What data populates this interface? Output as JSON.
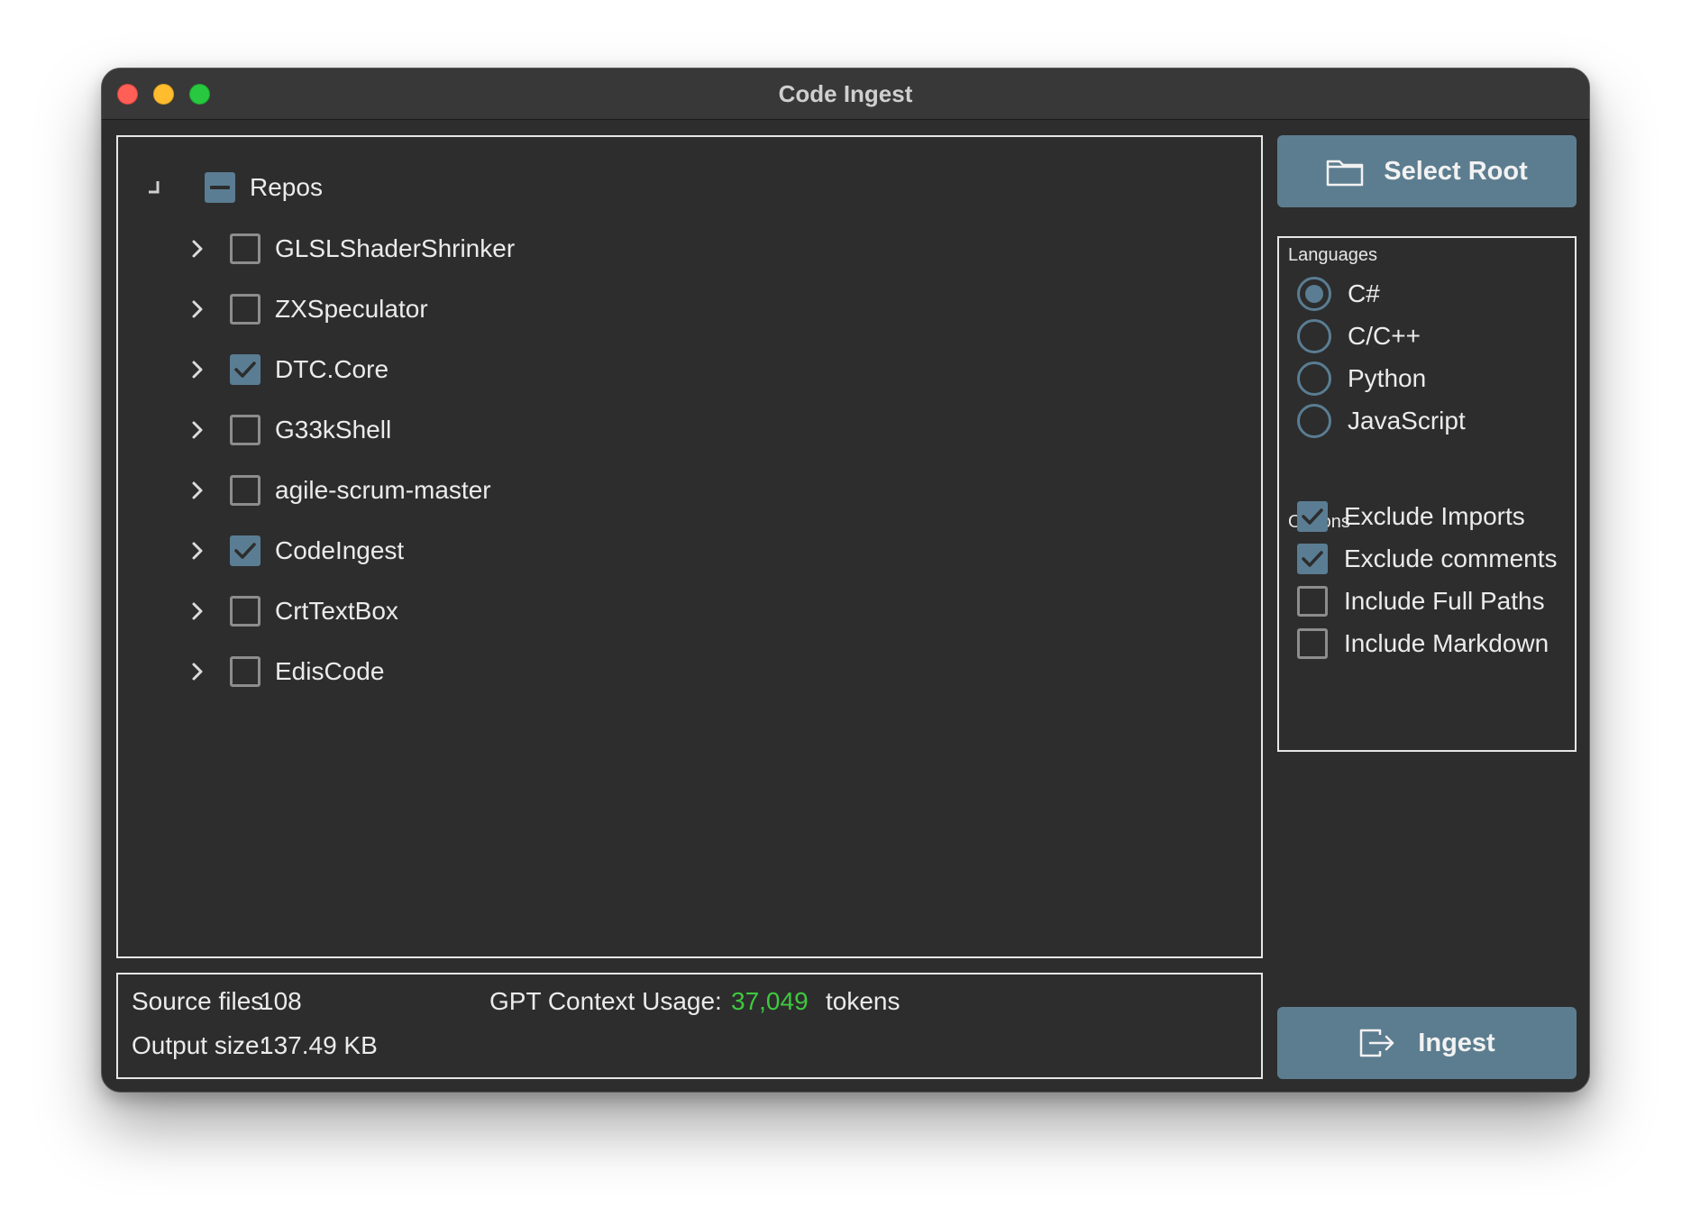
{
  "window": {
    "title": "Code Ingest"
  },
  "tree": {
    "root": {
      "label": "Repos",
      "state": "partial"
    },
    "items": [
      {
        "label": "GLSLShaderShrinker",
        "checked": false
      },
      {
        "label": "ZXSpeculator",
        "checked": false
      },
      {
        "label": "DTC.Core",
        "checked": true
      },
      {
        "label": "G33kShell",
        "checked": false
      },
      {
        "label": "agile-scrum-master",
        "checked": false
      },
      {
        "label": "CodeIngest",
        "checked": true
      },
      {
        "label": "CrtTextBox",
        "checked": false
      },
      {
        "label": "EdisCode",
        "checked": false
      }
    ]
  },
  "stats": {
    "source_files_label": "Source files:",
    "source_files_value": "108",
    "output_size_label": "Output size:",
    "output_size_value": "137.49 KB",
    "context_label": "GPT Context Usage:",
    "context_value": "37,049",
    "context_unit": "tokens"
  },
  "buttons": {
    "select_root": "Select Root",
    "ingest": "Ingest"
  },
  "languages": {
    "label": "Languages",
    "options": [
      {
        "label": "C#",
        "selected": true
      },
      {
        "label": "C/C++",
        "selected": false
      },
      {
        "label": "Python",
        "selected": false
      },
      {
        "label": "JavaScript",
        "selected": false
      }
    ]
  },
  "options": {
    "label": "Options",
    "items": [
      {
        "label": "Exclude Imports",
        "checked": true
      },
      {
        "label": "Exclude comments",
        "checked": true
      },
      {
        "label": "Include Full Paths",
        "checked": false
      },
      {
        "label": "Include Markdown",
        "checked": false
      }
    ]
  },
  "colors": {
    "accent": "#5a7d93",
    "button": "#5c7d8f",
    "tokens_value": "#3ec93e"
  }
}
